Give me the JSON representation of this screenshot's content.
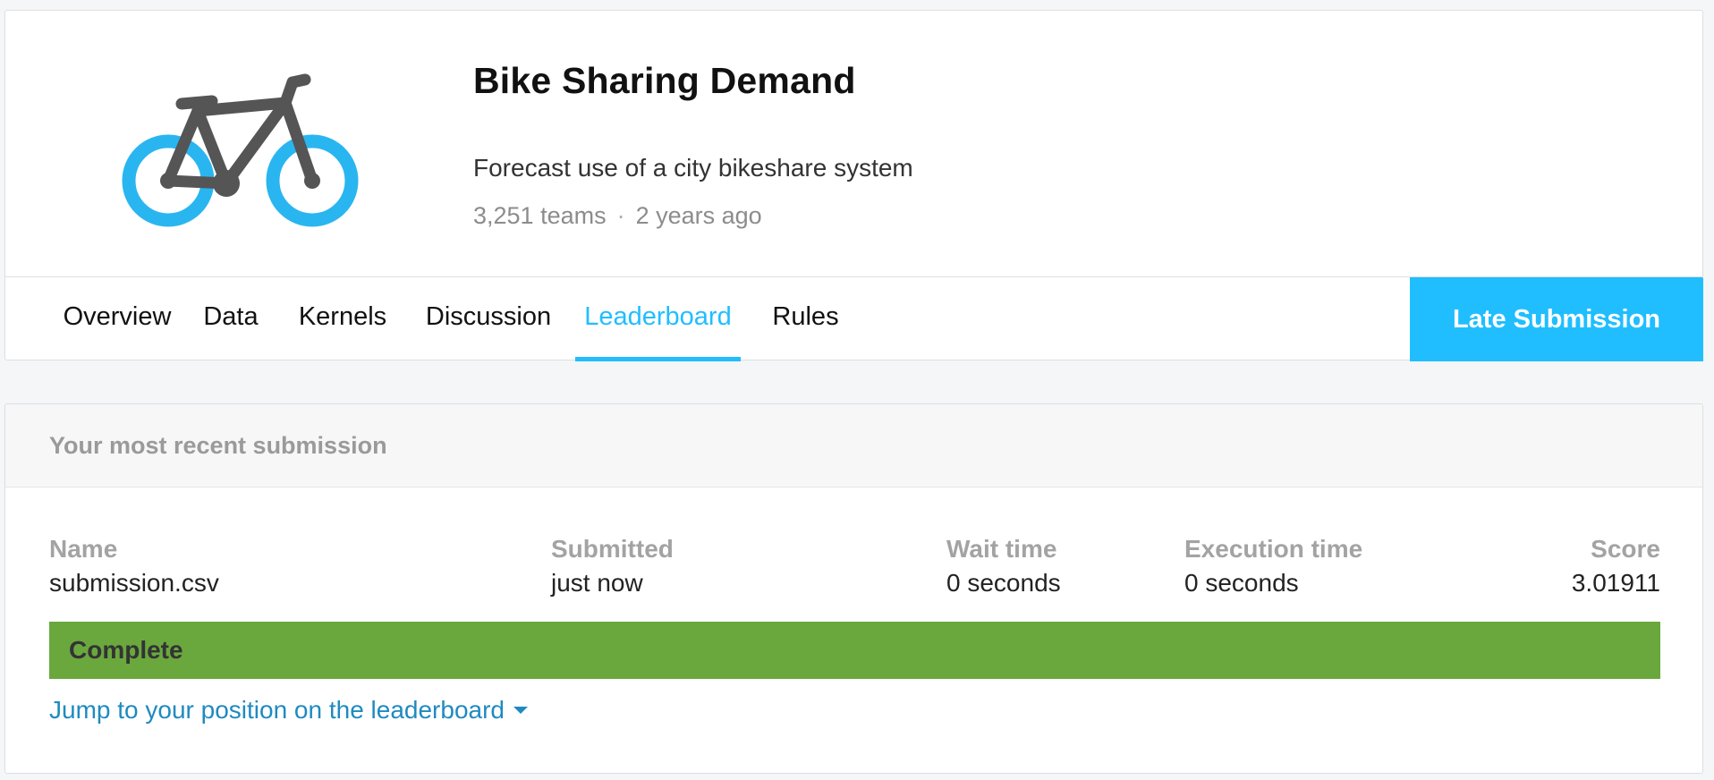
{
  "competition": {
    "title": "Bike Sharing Demand",
    "subtitle": "Forecast use of a city bikeshare system",
    "teams": "3,251 teams",
    "separator": "·",
    "age": "2 years ago",
    "logo_icon": "bicycle-icon"
  },
  "tabs": [
    {
      "label": "Overview",
      "active": false
    },
    {
      "label": "Data",
      "active": false
    },
    {
      "label": "Kernels",
      "active": false
    },
    {
      "label": "Discussion",
      "active": false
    },
    {
      "label": "Leaderboard",
      "active": true
    },
    {
      "label": "Rules",
      "active": false
    }
  ],
  "late_submission_label": "Late Submission",
  "submission": {
    "heading": "Your most recent submission",
    "columns": {
      "name": "Name",
      "submitted": "Submitted",
      "wait": "Wait time",
      "execution": "Execution time",
      "score": "Score"
    },
    "values": {
      "name": "submission.csv",
      "submitted": "just now",
      "wait": "0 seconds",
      "execution": "0 seconds",
      "score": "3.01911"
    },
    "status": "Complete",
    "jump_link": "Jump to your position on the leaderboard"
  },
  "colors": {
    "accent": "#20beff",
    "status_complete": "#6aa83e",
    "link": "#1f8ac0",
    "bike_frame": "#555555"
  }
}
